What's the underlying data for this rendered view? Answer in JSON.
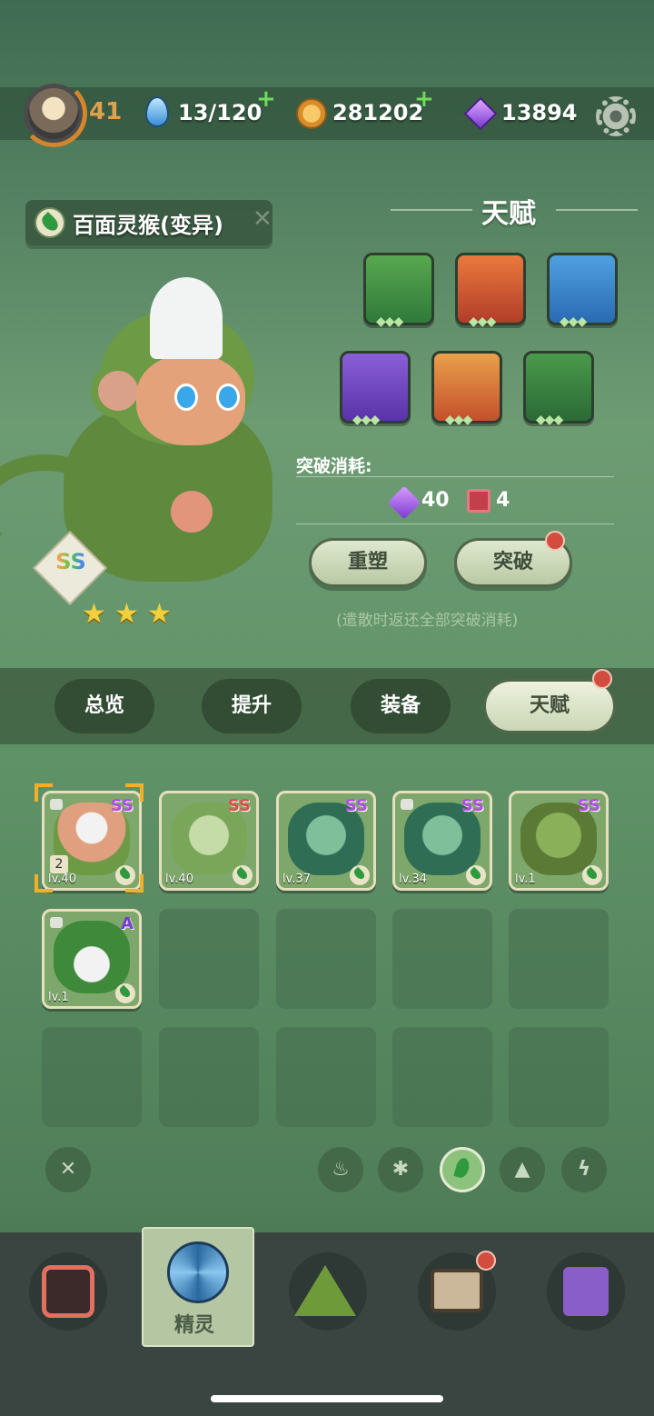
{
  "player": {
    "level": "41",
    "avatar_icon": "skull-avatar-icon"
  },
  "resources": {
    "stamina": "13/120",
    "coins": "281202",
    "gems": "13894"
  },
  "spirit": {
    "name": "百面灵猴(变异)",
    "rank": "SS",
    "stars": 3,
    "element": "grass"
  },
  "talent": {
    "title": "天赋",
    "icons": [
      "claw-icon",
      "fang-icon",
      "eye-icon",
      "lightning-icon",
      "hexagon-icon",
      "drop-icon"
    ],
    "breakthrough_label": "突破消耗:",
    "cost_gems": "40",
    "cost_books": "4",
    "reshape_label": "重塑",
    "breakthrough_button": "突破",
    "note": "(遣散时返还全部突破消耗)"
  },
  "tabs": [
    {
      "label": "总览"
    },
    {
      "label": "提升"
    },
    {
      "label": "装备"
    },
    {
      "label": "天赋"
    }
  ],
  "cards": [
    {
      "rank": "SS",
      "level": "lv.40",
      "badge": "2",
      "color": "#8fb07a"
    },
    {
      "rank": "SS",
      "level": "lv.40",
      "color": "#9fc081"
    },
    {
      "rank": "SS",
      "level": "lv.37",
      "color": "#4f8a6a"
    },
    {
      "rank": "SS",
      "level": "lv.34",
      "color": "#4f8a6a"
    },
    {
      "rank": "SS",
      "level": "lv.1",
      "color": "#6b8f4a"
    },
    {
      "rank": "A",
      "level": "lv.1",
      "color": "#5c9a55"
    }
  ],
  "filters": [
    "close-icon",
    "fire-icon",
    "snowflake-icon",
    "leaf-icon",
    "rock-icon",
    "lightning-icon"
  ],
  "nav": {
    "active_label": "精灵"
  }
}
